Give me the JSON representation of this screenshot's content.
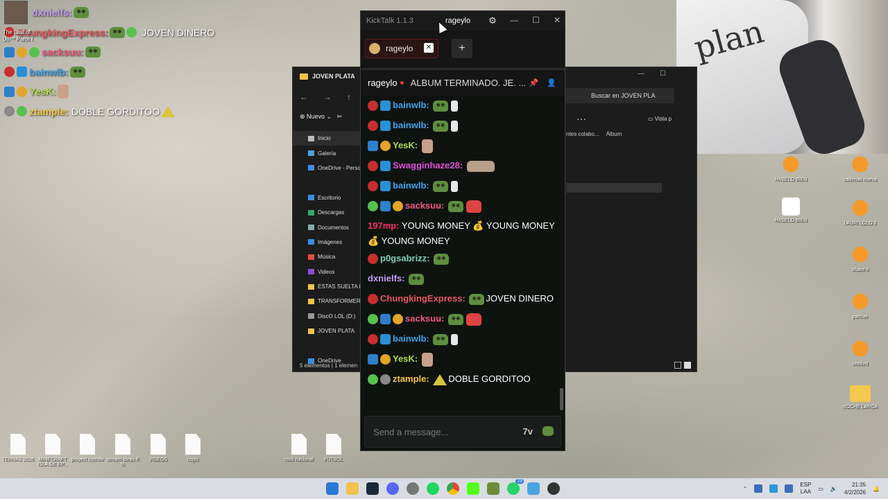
{
  "overlay": {
    "lines": [
      {
        "user": "dxnielfs:",
        "color": "#c39cf0",
        "text": ""
      },
      {
        "user": "ChungkingExpress:",
        "color": "#e8575d",
        "text": "JOVEN DINERO"
      },
      {
        "user": "sacksuu:",
        "color": "#f05c84",
        "text": ""
      },
      {
        "user": "bainwlb:",
        "color": "#3fa3e8",
        "text": ""
      },
      {
        "user": "YesK:",
        "color": "#b0de4c",
        "text": ""
      },
      {
        "user": "ztample:",
        "color": "#f5c54a",
        "text": "DOBLE GORDITOO"
      }
    ],
    "avatar_caption": "The Last of Us™ Parte I"
  },
  "explorer": {
    "title": "JOVEN PLATA",
    "new_label": "Nuevo",
    "search_placeholder": "Buscar en JOVEN PLA",
    "sidebar": [
      "Inicio",
      "Galería",
      "OneDrive - Person",
      "",
      "Escritorio",
      "Descargas",
      "Documentos",
      "Imágenes",
      "Música",
      "Videos",
      "ESTAS SUELTA RU",
      "TRANSFORMER",
      "DiscO LOL (D:)",
      "JOVEN PLATA",
      "",
      "OneDrive"
    ],
    "columns": [
      "ntes colabo...",
      "Álbum"
    ],
    "view_label": "Vista p",
    "status": "5 elementos  |  1 elemen"
  },
  "kicktalk": {
    "app_name": "KickTalk 1.1.3",
    "active_user": "rageylo",
    "tab_label": "rageylo",
    "stream_user": "rageylo",
    "stream_title": "ALBUM TERMINADO. JE. ...",
    "input_placeholder": "Send a message...",
    "messages": [
      {
        "badges": [
          "red",
          "blue"
        ],
        "user": "bainwlb:",
        "color": "#3fa3e8",
        "text": "",
        "emotes": [
          "pepe",
          "small"
        ]
      },
      {
        "badges": [
          "red",
          "blue"
        ],
        "user": "bainwlb:",
        "color": "#3fa3e8",
        "text": "",
        "emotes": [
          "pepe",
          "small"
        ]
      },
      {
        "badges": [
          "hammer",
          "gold"
        ],
        "user": "YesK:",
        "color": "#b0de4c",
        "text": "",
        "emotes": [
          "face"
        ]
      },
      {
        "badges": [
          "red",
          "blue"
        ],
        "user": "Swagginhaze28:",
        "color": "#e051d8",
        "text": "",
        "emotes": [
          "long"
        ]
      },
      {
        "badges": [
          "red",
          "blue"
        ],
        "user": "bainwlb:",
        "color": "#3fa3e8",
        "text": "",
        "emotes": [
          "pepe",
          "small"
        ]
      },
      {
        "badges": [
          "green",
          "hammer",
          "gold"
        ],
        "user": "sacksuu:",
        "color": "#f05c84",
        "text": "",
        "emotes": [
          "pepe",
          "dance"
        ]
      },
      {
        "badges": [],
        "user": "197mp:",
        "color": "#ff2d6a",
        "text": "YOUNG MONEY  💰 YOUNG MONEY  💰 YOUNG MONEY",
        "emotes": []
      },
      {
        "badges": [
          "red"
        ],
        "user": "p0gsabrizz:",
        "color": "#7ad1b6",
        "text": "",
        "emotes": [
          "pepe"
        ]
      },
      {
        "badges": [],
        "user": "dxnielfs:",
        "color": "#c39cf0",
        "text": "",
        "emotes": [
          "pepe"
        ]
      },
      {
        "badges": [
          "red"
        ],
        "user": "ChungkingExpress:",
        "color": "#e8575d",
        "text": "JOVEN DINERO",
        "emotes": [
          "pepe"
        ]
      },
      {
        "badges": [
          "green",
          "hammer",
          "gold"
        ],
        "user": "sacksuu:",
        "color": "#f05c84",
        "text": "",
        "emotes": [
          "pepe",
          "dance"
        ]
      },
      {
        "badges": [
          "red",
          "blue"
        ],
        "user": "bainwlb:",
        "color": "#3fa3e8",
        "text": "",
        "emotes": [
          "pepe",
          "small"
        ]
      },
      {
        "badges": [
          "hammer",
          "gold"
        ],
        "user": "YesK:",
        "color": "#b0de4c",
        "text": "",
        "emotes": [
          "face"
        ]
      },
      {
        "badges": [
          "green",
          "gray"
        ],
        "user": "ztample:",
        "color": "#f5c54a",
        "text": "DOBLE GORDITOO",
        "emotes": [
          "tri"
        ]
      }
    ]
  },
  "desktop_icons": [
    {
      "label": "TERNAS 2026",
      "type": "file"
    },
    {
      "label": "MINECRAFT ISLA DE EP...",
      "type": "file"
    },
    {
      "label": "proyect comolv",
      "type": "file"
    },
    {
      "label": "stream ideas ff fs",
      "type": "file"
    },
    {
      "label": "VIDEOS",
      "type": "file"
    },
    {
      "label": "copis",
      "type": "file"
    },
    {
      "label": "rock nacional",
      "type": "file"
    },
    {
      "label": "FUTBOL",
      "type": "file"
    },
    {
      "label": "HASELO BIEN",
      "type": "fl"
    },
    {
      "label": "cadenas nueva",
      "type": "fl"
    },
    {
      "label": "HASELO BIEN",
      "type": "video"
    },
    {
      "label": "LAURI LOLO 2",
      "type": "fl"
    },
    {
      "label": "shake it",
      "type": "fl"
    },
    {
      "label": "partner",
      "type": "fl"
    },
    {
      "label": "untitled",
      "type": "fl"
    },
    {
      "label": "NOCHE LARGA",
      "type": "folder"
    }
  ],
  "taskbar": {
    "lang_top": "ESP",
    "lang_bottom": "LAA",
    "time": "21:35",
    "date": "4/2/2026",
    "badge_count": "29"
  },
  "webcam": {
    "shirt_text": "plan"
  }
}
